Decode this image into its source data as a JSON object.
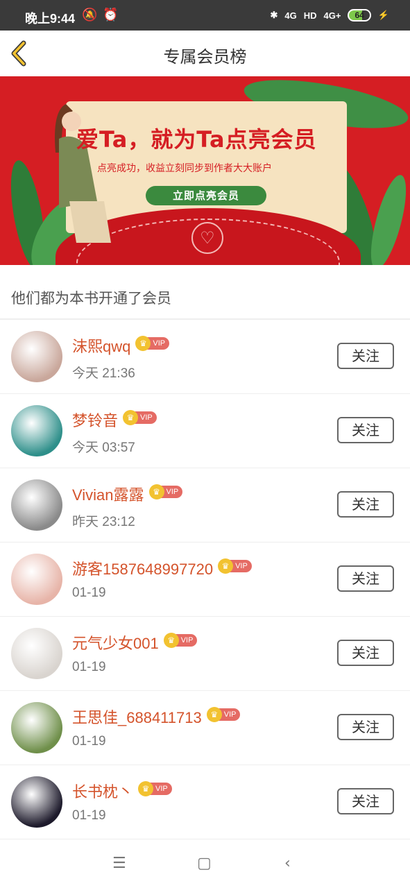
{
  "status_bar": {
    "time": "晚上9:44",
    "signal1": "4G",
    "hd": "HD",
    "signal2": "4G+",
    "battery": "64"
  },
  "header": {
    "title": "专属会员榜"
  },
  "banner": {
    "headline": "爱Ta，就为Ta点亮会员",
    "subline": "点亮成功，收益立刻同步到作者大大账户",
    "button_label": "立即点亮会员"
  },
  "section_title": "他们都为本书开通了会员",
  "members": [
    {
      "name": "沫熙qwq",
      "badge": "VIP",
      "time": "今天 21:36",
      "follow": "关注",
      "avatar_color": "#c9a79b"
    },
    {
      "name": "梦铃音",
      "badge": "VIP",
      "time": "今天 03:57",
      "follow": "关注",
      "avatar_color": "#2e8f8a"
    },
    {
      "name": "Vivian露露",
      "badge": "VIP",
      "time": "昨天 23:12",
      "follow": "关注",
      "avatar_color": "#8a8a8a"
    },
    {
      "name": "游客1587648997720",
      "badge": "VIP",
      "time": "01-19",
      "follow": "关注",
      "avatar_color": "#e7b4a8"
    },
    {
      "name": "元气少女001",
      "badge": "VIP",
      "time": "01-19",
      "follow": "关注",
      "avatar_color": "#d9d4cf"
    },
    {
      "name": "王思佳_688411713",
      "badge": "VIP",
      "time": "01-19",
      "follow": "关注",
      "avatar_color": "#6f8f4a"
    },
    {
      "name": "长书枕丶",
      "badge": "VIP",
      "time": "01-19",
      "follow": "关注",
      "avatar_color": "#1d1a2b"
    }
  ],
  "colors": {
    "accent": "#d4532b",
    "banner_red": "#d51e23",
    "vip_badge": "#e56b64",
    "crown_gold": "#f2c230"
  }
}
